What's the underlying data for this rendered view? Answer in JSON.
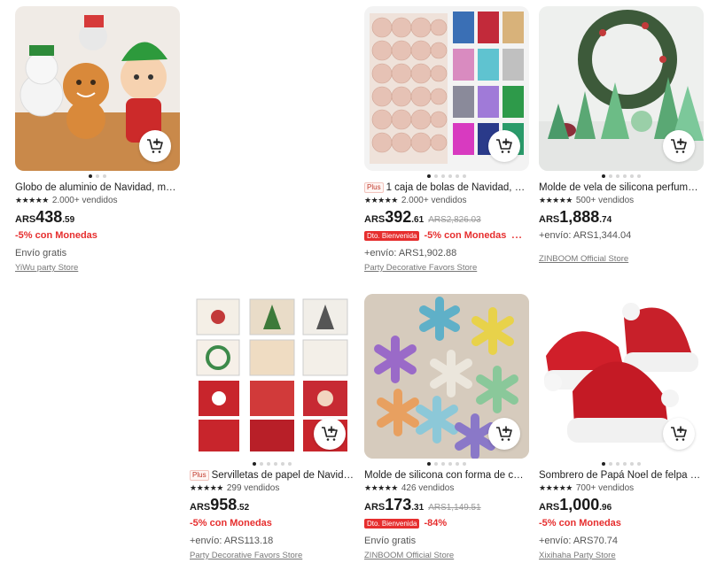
{
  "cart_icon": "cart-add-icon",
  "colors": {
    "promo": "#e62e2e",
    "text": "#191919",
    "muted": "#777777"
  },
  "products": [
    {
      "title": "Globo de aluminio de Navidad, mu...",
      "rating_stars": "★★★★★",
      "sold": "2.000+ vendidos",
      "currency": "ARS",
      "price_int": "438",
      "price_cents": ".59",
      "coins": "-5% con Monedas",
      "shipping": "Envío gratis",
      "store": "YiWu party Store"
    },
    {
      "plus": "Plus",
      "title": "1 caja de bolas de Navidad, ad...",
      "rating_stars": "★★★★★",
      "sold": "2.000+ vendidos",
      "currency": "ARS",
      "price_int": "392",
      "price_cents": ".61",
      "old_price": "ARS2,826.03",
      "badge": "Dto. Bienvenida",
      "coins": "-5% con Monedas",
      "more": "...",
      "shipping": "+envío: ARS1,902.88",
      "store": "Party Decorative Favors Store"
    },
    {
      "title": "Molde de vela de silicona perfumad...",
      "rating_stars": "★★★★★",
      "sold": "500+ vendidos",
      "currency": "ARS",
      "price_int": "1,888",
      "price_cents": ".74",
      "shipping": "+envío: ARS1,344.04",
      "store": "ZINBOOM Official Store"
    },
    {
      "plus": "Plus",
      "title": "Servilletas de papel de Navida...",
      "rating_stars": "★★★★★",
      "sold": "299 vendidos",
      "currency": "ARS",
      "price_int": "958",
      "price_cents": ".52",
      "coins": "-5% con Monedas",
      "shipping": "+envío: ARS113.18",
      "store": "Party Decorative Favors Store"
    },
    {
      "title": "Molde de silicona con forma de cop...",
      "rating_stars": "★★★★★",
      "sold": "426 vendidos",
      "currency": "ARS",
      "price_int": "173",
      "price_cents": ".31",
      "old_price": "ARS1,149.51",
      "badge": "Dto. Bienvenida",
      "coins": "-84%",
      "shipping": "Envío gratis",
      "store": "ZINBOOM Official Store"
    },
    {
      "title": "Sombrero de Papá Noel de felpa pa...",
      "rating_stars": "★★★★★",
      "sold": "700+ vendidos",
      "currency": "ARS",
      "price_int": "1,000",
      "price_cents": ".96",
      "coins": "-5% con Monedas",
      "shipping": "+envío: ARS70.74",
      "store": "Xixihaha Party Store"
    }
  ]
}
